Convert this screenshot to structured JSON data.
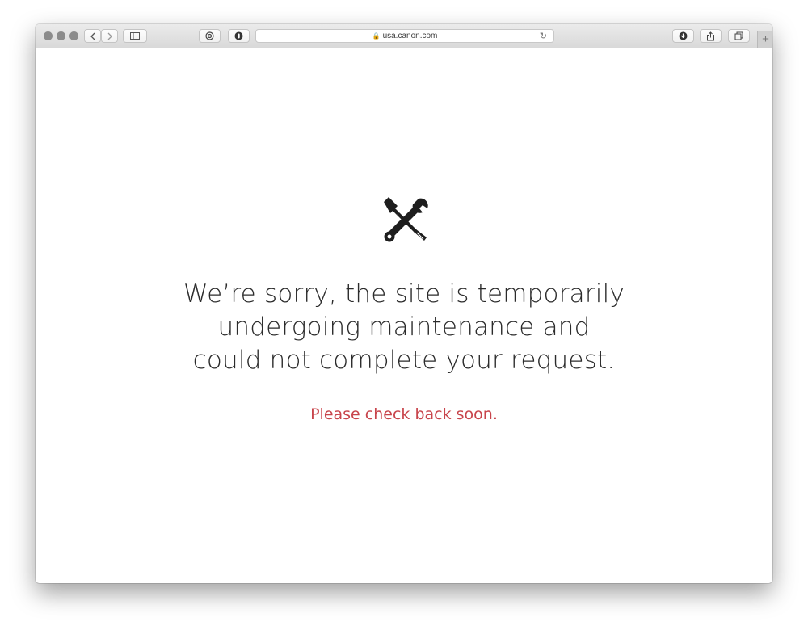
{
  "browser": {
    "url": "usa.canon.com",
    "new_tab_label": "+"
  },
  "page": {
    "headline_lines": [
      "We’re sorry, the site is temporarily",
      "undergoing maintenance and",
      "could not complete your request."
    ],
    "subtext": "Please check back soon.",
    "icon": "wrench-screwdriver-icon"
  },
  "colors": {
    "headline": "#2b2b2b",
    "subtext": "#c8444b"
  }
}
